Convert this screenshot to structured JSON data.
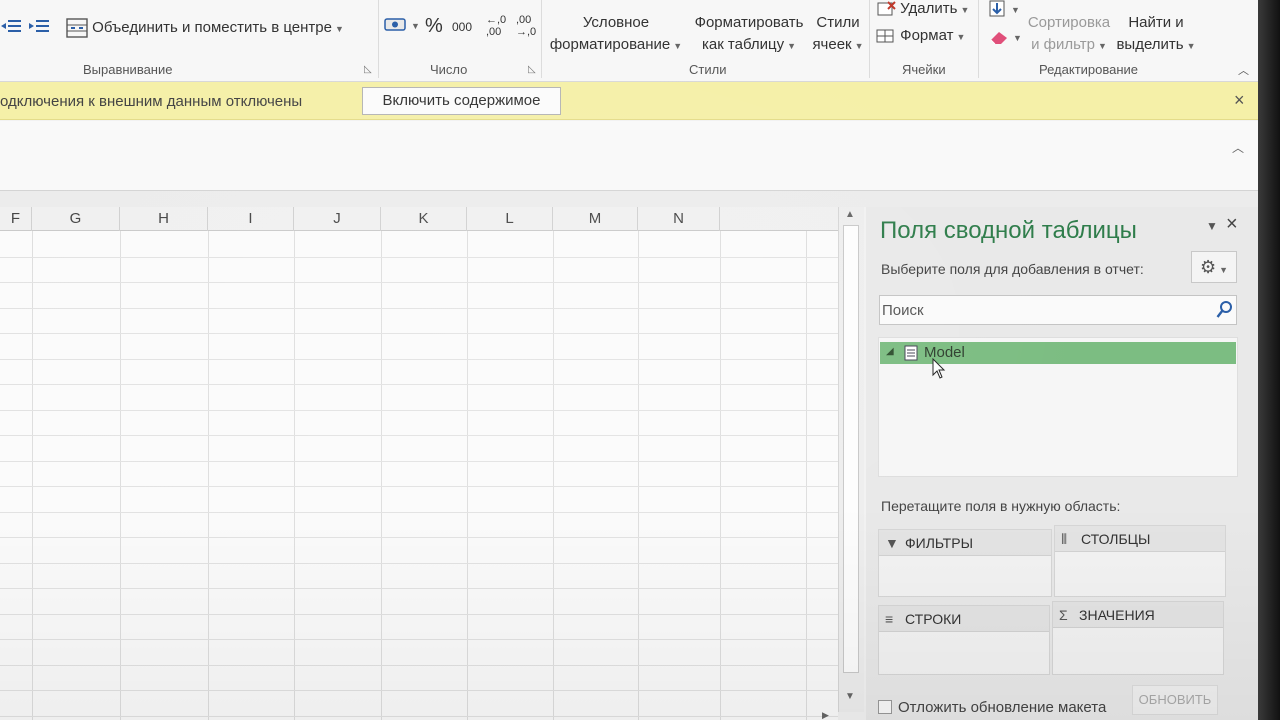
{
  "ribbon": {
    "merge_center_label": "Объединить и поместить в центре",
    "number_percent": "%",
    "number_thousands": "000",
    "decimal_increase": "←,0 ,00",
    "decimal_decrease": ",00 →,0",
    "cond_format_l1": "Условное",
    "cond_format_l2": "форматирование",
    "format_table_l1": "Форматировать",
    "format_table_l2": "как таблицу",
    "cell_styles_l1": "Стили",
    "cell_styles_l2": "ячеек",
    "delete_label": "Удалить",
    "format_label": "Формат",
    "sort_l1": "Сортировка",
    "sort_l2": "и фильтр",
    "find_l1": "Найти и",
    "find_l2": "выделить",
    "groups": {
      "alignment": "Выравнивание",
      "number": "Число",
      "styles": "Стили",
      "cells": "Ячейки",
      "editing": "Редактирование"
    }
  },
  "message_bar": {
    "text": "одключения к внешним данным отключены",
    "button": "Включить содержимое",
    "close": "×"
  },
  "grid": {
    "columns": [
      "F",
      "G",
      "H",
      "I",
      "J",
      "K",
      "L",
      "M",
      "N"
    ]
  },
  "pivot_pane": {
    "title": "Поля сводной таблицы",
    "close": "×",
    "choose_fields_prompt": "Выберите поля для добавления в отчет:",
    "search_placeholder": "Поиск",
    "tables": [
      "Model"
    ],
    "drag_prompt": "Перетащите поля в нужную область:",
    "areas": {
      "filters": "ФИЛЬТРЫ",
      "columns": "СТОЛБЦЫ",
      "rows": "СТРОКИ",
      "values": "ЗНАЧЕНИЯ"
    },
    "defer_update_label": "Отложить обновление макета",
    "update_button": "ОБНОВИТЬ"
  },
  "colors": {
    "pane_title": "#2f7d4b",
    "selected_row": "#7cbd82",
    "message_bar": "#f5f0a8"
  }
}
